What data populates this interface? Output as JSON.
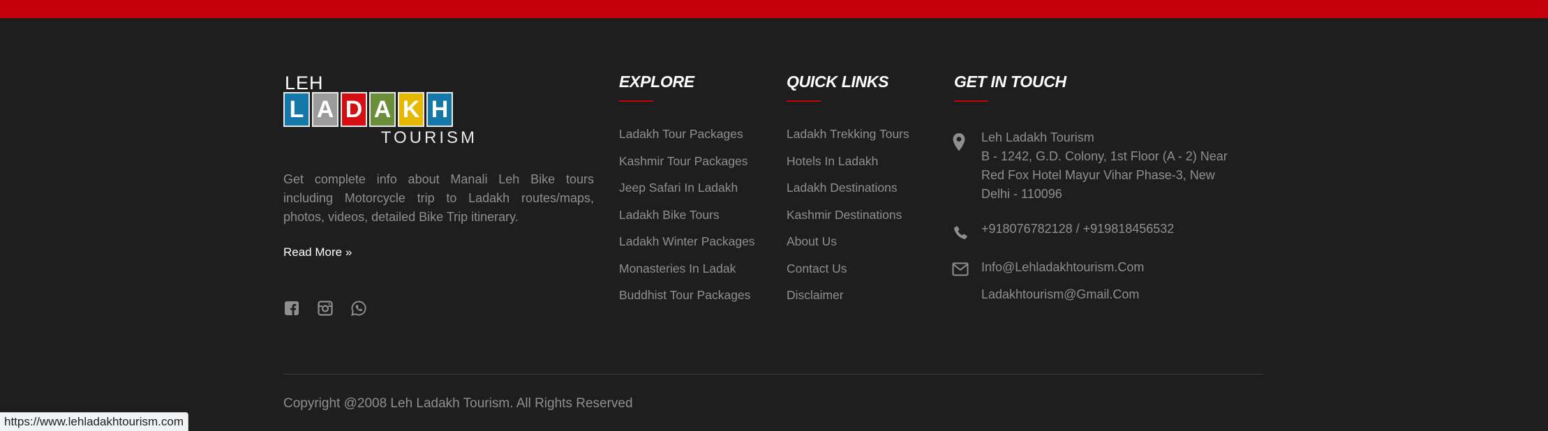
{
  "logo": {
    "top_text": "LEH",
    "tiles": [
      {
        "letter": "L",
        "color": "#1479a8"
      },
      {
        "letter": "A",
        "color": "#9b9b9b"
      },
      {
        "letter": "D",
        "color": "#d40e12"
      },
      {
        "letter": "A",
        "color": "#6b8e3a"
      },
      {
        "letter": "K",
        "color": "#e6b800"
      },
      {
        "letter": "H",
        "color": "#1479a8"
      }
    ],
    "bottom_text": "TOURISM"
  },
  "about": {
    "text": "Get complete info about Manali Leh Bike tours including Motorcycle trip to Ladakh routes/maps, photos, videos, detailed Bike Trip itinerary.",
    "read_more": "Read More »"
  },
  "social": [
    "facebook-icon",
    "instagram-icon",
    "whatsapp-icon"
  ],
  "explore": {
    "title": "EXPLORE",
    "links": [
      "Ladakh Tour Packages",
      "Kashmir Tour Packages",
      "Jeep Safari In Ladakh",
      "Ladakh Bike Tours",
      "Ladakh Winter Packages",
      "Monasteries In Ladak",
      "Buddhist Tour Packages"
    ]
  },
  "quick_links": {
    "title": "QUICK LINKS",
    "links": [
      "Ladakh Trekking Tours",
      "Hotels In Ladakh",
      "Ladakh Destinations",
      "Kashmir Destinations",
      "About Us",
      "Contact Us",
      "Disclaimer"
    ]
  },
  "contact": {
    "title": "GET IN TOUCH",
    "address_lines": [
      "Leh Ladakh Tourism",
      "B - 1242, G.D. Colony, 1st Floor (A - 2) Near",
      "Red Fox Hotel Mayur Vihar Phase-3, New",
      "Delhi - 110096"
    ],
    "phone": "+918076782128 / +919818456532",
    "email1": "Info@Lehladakhtourism.Com",
    "email2": "Ladakhtourism@Gmail.Com"
  },
  "copyright": "Copyright @2008 Leh Ladakh Tourism. All Rights Reserved",
  "status_url": "https://www.lehladakhtourism.com",
  "colors": {
    "accent": "#c4000b",
    "background": "#1e1e1e",
    "muted_text": "#8f8f8f"
  }
}
